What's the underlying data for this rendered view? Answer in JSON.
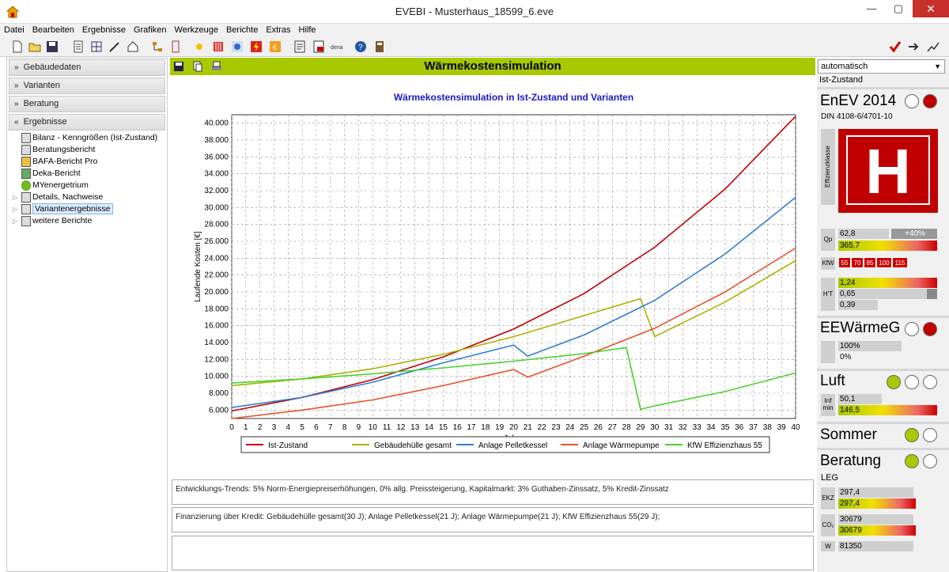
{
  "window": {
    "title": "EVEBI - Musterhaus_18599_6.eve",
    "min": "—",
    "max": "▢",
    "close": "✕"
  },
  "menu": [
    "Datei",
    "Bearbeiten",
    "Ergebnisse",
    "Grafiken",
    "Werkzeuge",
    "Berichte",
    "Extras",
    "Hilfe"
  ],
  "sidebar": {
    "sections": [
      "Gebäudedaten",
      "Varianten",
      "Beratung",
      "Ergebnisse"
    ],
    "tree": [
      {
        "label": "Bilanz - Kenngrößen (Ist-Zustand)",
        "expandable": false,
        "selected": false
      },
      {
        "label": "Beratungsbericht",
        "expandable": false,
        "selected": false
      },
      {
        "label": "BAFA-Bericht Pro",
        "expandable": false,
        "selected": false
      },
      {
        "label": "Deka-Bericht",
        "expandable": false,
        "selected": false
      },
      {
        "label": "MYenergetrium",
        "expandable": false,
        "selected": false
      },
      {
        "label": "Details, Nachweise",
        "expandable": true,
        "selected": false
      },
      {
        "label": "Variantenergebnisse",
        "expandable": true,
        "selected": true
      },
      {
        "label": "weitere Berichte",
        "expandable": true,
        "selected": false
      }
    ]
  },
  "main": {
    "header": "Wärmekostensimulation",
    "info1": "Entwicklungs-Trends: 5% Norm-Energiepreiserhöhungen, 0% allg. Preissteigerung, Kapitalmarkt: 3% Guthaben-Zinssatz, 5% Kredit-Zinssatz",
    "info2": "Finanzierung über Kredit:   Gebäudehülle gesamt(30 J); Anlage Pelletkessel(21 J); Anlage Wärmepumpe(21 J); KfW Effizienzhaus 55(29 J);"
  },
  "chart_data": {
    "type": "line",
    "title": "Wärmekostensimulation in Ist-Zustand und Varianten",
    "xlabel": "Jahre",
    "ylabel": "Laufende Kosten [€]",
    "xlim": [
      0,
      40
    ],
    "ylim": [
      5000,
      41000
    ],
    "yticks": [
      6000,
      8000,
      10000,
      12000,
      14000,
      16000,
      18000,
      20000,
      22000,
      24000,
      26000,
      28000,
      30000,
      32000,
      34000,
      36000,
      38000,
      40000
    ],
    "ytick_labels": [
      "6.000",
      "8.000",
      "10.000",
      "12.000",
      "14.000",
      "16.000",
      "18.000",
      "20.000",
      "22.000",
      "24.000",
      "26.000",
      "28.000",
      "30.000",
      "32.000",
      "34.000",
      "36.000",
      "38.000",
      "40.000"
    ],
    "grid": true,
    "legend_position": "bottom",
    "series": [
      {
        "name": "Ist-Zustand",
        "color": "#c00000",
        "x": [
          0,
          5,
          10,
          15,
          20,
          25,
          30,
          35,
          40
        ],
        "y": [
          5900,
          7500,
          9600,
          12300,
          15600,
          19800,
          25300,
          32200,
          40800
        ]
      },
      {
        "name": "Gebäudehülle gesamt",
        "color": "#a8b400",
        "x": [
          0,
          5,
          10,
          15,
          20,
          25,
          29,
          30,
          35,
          40
        ],
        "y": [
          8900,
          9700,
          10900,
          12600,
          14700,
          17200,
          19200,
          14700,
          18800,
          23700
        ]
      },
      {
        "name": "Anlage Pelletkessel",
        "color": "#2f7ed8",
        "x": [
          0,
          5,
          10,
          15,
          20,
          21,
          25,
          30,
          35,
          40
        ],
        "y": [
          6300,
          7500,
          9300,
          11600,
          13700,
          12400,
          14900,
          19000,
          24500,
          31200
        ]
      },
      {
        "name": "Anlage Wärmepumpe",
        "color": "#e8502a",
        "x": [
          0,
          5,
          10,
          15,
          20,
          21,
          25,
          30,
          35,
          40
        ],
        "y": [
          5000,
          6000,
          7200,
          8900,
          10800,
          9900,
          12400,
          15700,
          20000,
          25200
        ]
      },
      {
        "name": "KfW Effizienzhaus 55",
        "color": "#4ccf2e",
        "x": [
          0,
          5,
          10,
          15,
          20,
          25,
          28,
          29,
          30,
          35,
          40
        ],
        "y": [
          9200,
          9700,
          10300,
          11000,
          11800,
          12700,
          13400,
          6100,
          6500,
          8200,
          10400
        ]
      }
    ]
  },
  "right": {
    "combo": "automatisch",
    "state": "Ist-Zustand",
    "enev": "EnEV 2014",
    "din": "DIN 4108-6/4701-10",
    "eff_label": "Effizienzklasse",
    "eff_class": "H",
    "qp1": "62,8",
    "qp_pct": "+40%",
    "qp2": "365,7",
    "kfw": [
      "55",
      "70",
      "85",
      "100",
      "115"
    ],
    "ht1": "1,24",
    "ht2": "0,65",
    "ht3": "0,39",
    "eewg": "EEWärmeG",
    "ee1": "100%",
    "ee2": "0%",
    "luft": "Luft",
    "luft1": "50,1",
    "luft2": "146,5",
    "sommer": "Sommer",
    "beratung": "Beratung",
    "leg": "LEG",
    "ekz1": "297,4",
    "ekz2": "297,4",
    "co1": "30679",
    "co2": "30679",
    "last": "81350",
    "lab_qp": "Qp",
    "lab_kfw": "KfW",
    "lab_ht": "H'T",
    "lab_inf": "Inf min",
    "lab_ekz": "EKZ",
    "lab_co2": "CO₂",
    "lab_w": "W",
    "colors": {
      "red": "#c00000",
      "green": "#a8c800"
    }
  }
}
